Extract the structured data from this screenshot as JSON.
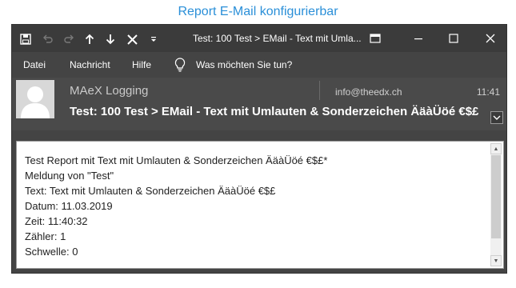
{
  "caption": "Report E-Mail konfigurierbar",
  "titlebar": {
    "title": "Test: 100 Test > EMail - Text mit Umla...",
    "icons": [
      "save-icon",
      "undo-icon",
      "redo-icon",
      "arrow-up-icon",
      "arrow-down-icon",
      "close-x-icon",
      "customize-toolbar-icon"
    ],
    "window_controls": [
      "restore-panel-icon",
      "minimize-icon",
      "maximize-icon",
      "close-icon"
    ]
  },
  "menu": {
    "items": [
      "Datei",
      "Nachricht",
      "Hilfe"
    ],
    "tell_me": "Was möchten Sie tun?"
  },
  "header": {
    "sender": "MAeX Logging",
    "email": "info@theedx.ch",
    "time": "11:41",
    "subject": "Test: 100 Test > EMail - Text mit Umlauten & Sonderzeichen ÄäàÜöé €$£"
  },
  "body": {
    "lines": [
      "Test Report mit Text mit Umlauten & Sonderzeichen ÄäàÜöé €$£*",
      "Meldung von \"Test\"",
      "Text: Text mit Umlauten & Sonderzeichen ÄäàÜöé €$£",
      "Datum: 11.03.2019",
      "Zeit: 11:40:32",
      "Zähler: 1",
      "Schwelle: 0"
    ]
  },
  "colors": {
    "caption": "#2a8fd8",
    "titlebar": "#3b3b3b",
    "chrome": "#444444",
    "header": "#4a4a4a"
  }
}
